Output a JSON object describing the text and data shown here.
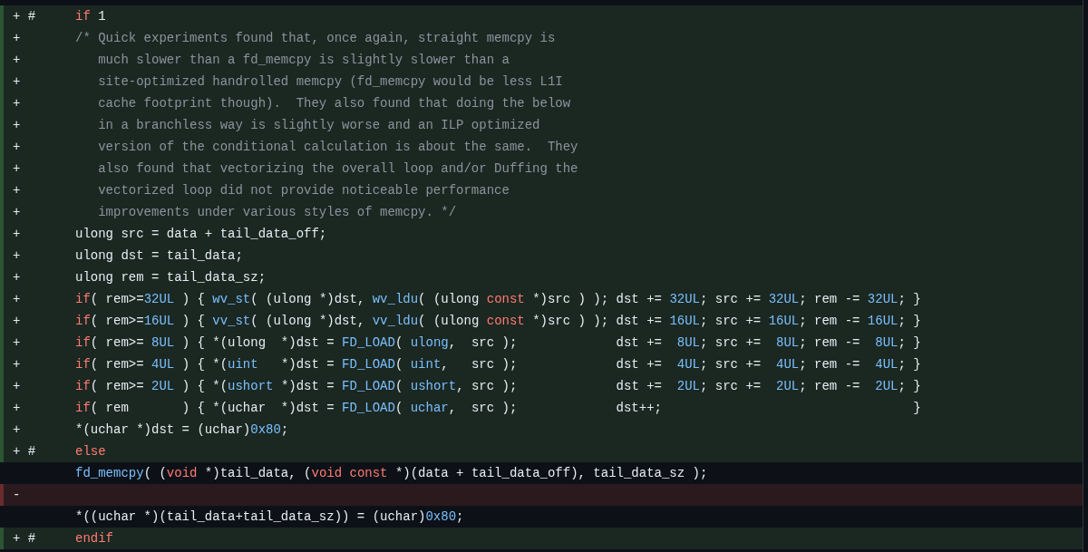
{
  "diff_lines": [
    {
      "kind": "add",
      "marker": "+ #",
      "code": [
        {
          "kind": "kw",
          "s": "if"
        },
        {
          "kind": "p",
          "s": " 1"
        }
      ]
    },
    {
      "kind": "add",
      "marker": "+",
      "code": [
        {
          "kind": "cm",
          "s": "/* Quick experiments found that, once again, straight memcpy is"
        }
      ]
    },
    {
      "kind": "add",
      "marker": "+",
      "code": [
        {
          "kind": "cm",
          "s": "   much slower than a fd_memcpy is slightly slower than a"
        }
      ]
    },
    {
      "kind": "add",
      "marker": "+",
      "code": [
        {
          "kind": "cm",
          "s": "   site-optimized handrolled memcpy (fd_memcpy would be less L1I"
        }
      ]
    },
    {
      "kind": "add",
      "marker": "+",
      "code": [
        {
          "kind": "cm",
          "s": "   cache footprint though).  They also found that doing the below"
        }
      ]
    },
    {
      "kind": "add",
      "marker": "+",
      "code": [
        {
          "kind": "cm",
          "s": "   in a branchless way is slightly worse and an ILP optimized"
        }
      ]
    },
    {
      "kind": "add",
      "marker": "+",
      "code": [
        {
          "kind": "cm",
          "s": "   version of the conditional calculation is about the same.  They"
        }
      ]
    },
    {
      "kind": "add",
      "marker": "+",
      "code": [
        {
          "kind": "cm",
          "s": "   also found that vectorizing the overall loop and/or Duffing the"
        }
      ]
    },
    {
      "kind": "add",
      "marker": "+",
      "code": [
        {
          "kind": "cm",
          "s": "   vectorized loop did not provide noticeable performance"
        }
      ]
    },
    {
      "kind": "add",
      "marker": "+",
      "code": [
        {
          "kind": "cm",
          "s": "   improvements under various styles of memcpy. */"
        }
      ]
    },
    {
      "kind": "add",
      "marker": "+",
      "code": [
        {
          "kind": "p",
          "s": "ulong src = data + tail_data_off;"
        }
      ]
    },
    {
      "kind": "add",
      "marker": "+",
      "code": [
        {
          "kind": "p",
          "s": "ulong dst = tail_data;"
        }
      ]
    },
    {
      "kind": "add",
      "marker": "+",
      "code": [
        {
          "kind": "p",
          "s": "ulong rem = tail_data_sz;"
        }
      ]
    },
    {
      "kind": "add",
      "marker": "+",
      "code": [
        {
          "kind": "kw",
          "s": "if"
        },
        {
          "kind": "p",
          "s": "( rem>="
        },
        {
          "kind": "fn",
          "s": "32UL"
        },
        {
          "kind": "p",
          "s": " ) { "
        },
        {
          "kind": "fn",
          "s": "wv_st"
        },
        {
          "kind": "p",
          "s": "( (ulong *)dst, "
        },
        {
          "kind": "fn",
          "s": "wv_ldu"
        },
        {
          "kind": "p",
          "s": "( (ulong "
        },
        {
          "kind": "kw",
          "s": "const"
        },
        {
          "kind": "p",
          "s": " *)src ) ); dst += "
        },
        {
          "kind": "fn",
          "s": "32UL"
        },
        {
          "kind": "p",
          "s": "; src += "
        },
        {
          "kind": "fn",
          "s": "32UL"
        },
        {
          "kind": "p",
          "s": "; rem -= "
        },
        {
          "kind": "fn",
          "s": "32UL"
        },
        {
          "kind": "p",
          "s": "; }"
        }
      ]
    },
    {
      "kind": "add",
      "marker": "+",
      "code": [
        {
          "kind": "kw",
          "s": "if"
        },
        {
          "kind": "p",
          "s": "( rem>="
        },
        {
          "kind": "fn",
          "s": "16UL"
        },
        {
          "kind": "p",
          "s": " ) { "
        },
        {
          "kind": "fn",
          "s": "vv_st"
        },
        {
          "kind": "p",
          "s": "( (ulong *)dst, "
        },
        {
          "kind": "fn",
          "s": "vv_ldu"
        },
        {
          "kind": "p",
          "s": "( (ulong "
        },
        {
          "kind": "kw",
          "s": "const"
        },
        {
          "kind": "p",
          "s": " *)src ) ); dst += "
        },
        {
          "kind": "fn",
          "s": "16UL"
        },
        {
          "kind": "p",
          "s": "; src += "
        },
        {
          "kind": "fn",
          "s": "16UL"
        },
        {
          "kind": "p",
          "s": "; rem -= "
        },
        {
          "kind": "fn",
          "s": "16UL"
        },
        {
          "kind": "p",
          "s": "; }"
        }
      ]
    },
    {
      "kind": "add",
      "marker": "+",
      "code": [
        {
          "kind": "kw",
          "s": "if"
        },
        {
          "kind": "p",
          "s": "( rem>= "
        },
        {
          "kind": "fn",
          "s": "8UL"
        },
        {
          "kind": "p",
          "s": " ) { *(ulong  *)dst = "
        },
        {
          "kind": "fn",
          "s": "FD_LOAD"
        },
        {
          "kind": "p",
          "s": "( "
        },
        {
          "kind": "fn",
          "s": "ulong"
        },
        {
          "kind": "p",
          "s": ",  src );             dst +=  "
        },
        {
          "kind": "fn",
          "s": "8UL"
        },
        {
          "kind": "p",
          "s": "; src +=  "
        },
        {
          "kind": "fn",
          "s": "8UL"
        },
        {
          "kind": "p",
          "s": "; rem -=  "
        },
        {
          "kind": "fn",
          "s": "8UL"
        },
        {
          "kind": "p",
          "s": "; }"
        }
      ]
    },
    {
      "kind": "add",
      "marker": "+",
      "code": [
        {
          "kind": "kw",
          "s": "if"
        },
        {
          "kind": "p",
          "s": "( rem>= "
        },
        {
          "kind": "fn",
          "s": "4UL"
        },
        {
          "kind": "p",
          "s": " ) { *("
        },
        {
          "kind": "fn",
          "s": "uint"
        },
        {
          "kind": "p",
          "s": "   *)dst = "
        },
        {
          "kind": "fn",
          "s": "FD_LOAD"
        },
        {
          "kind": "p",
          "s": "( "
        },
        {
          "kind": "fn",
          "s": "uint"
        },
        {
          "kind": "p",
          "s": ",   src );             dst +=  "
        },
        {
          "kind": "fn",
          "s": "4UL"
        },
        {
          "kind": "p",
          "s": "; src +=  "
        },
        {
          "kind": "fn",
          "s": "4UL"
        },
        {
          "kind": "p",
          "s": "; rem -=  "
        },
        {
          "kind": "fn",
          "s": "4UL"
        },
        {
          "kind": "p",
          "s": "; }"
        }
      ]
    },
    {
      "kind": "add",
      "marker": "+",
      "code": [
        {
          "kind": "kw",
          "s": "if"
        },
        {
          "kind": "p",
          "s": "( rem>= "
        },
        {
          "kind": "fn",
          "s": "2UL"
        },
        {
          "kind": "p",
          "s": " ) { *("
        },
        {
          "kind": "fn",
          "s": "ushort"
        },
        {
          "kind": "p",
          "s": " *)dst = "
        },
        {
          "kind": "fn",
          "s": "FD_LOAD"
        },
        {
          "kind": "p",
          "s": "( "
        },
        {
          "kind": "fn",
          "s": "ushort"
        },
        {
          "kind": "p",
          "s": ", src );             dst +=  "
        },
        {
          "kind": "fn",
          "s": "2UL"
        },
        {
          "kind": "p",
          "s": "; src +=  "
        },
        {
          "kind": "fn",
          "s": "2UL"
        },
        {
          "kind": "p",
          "s": "; rem -=  "
        },
        {
          "kind": "fn",
          "s": "2UL"
        },
        {
          "kind": "p",
          "s": "; }"
        }
      ]
    },
    {
      "kind": "add",
      "marker": "+",
      "code": [
        {
          "kind": "kw",
          "s": "if"
        },
        {
          "kind": "p",
          "s": "( rem       ) { *(uchar  *)dst = "
        },
        {
          "kind": "fn",
          "s": "FD_LOAD"
        },
        {
          "kind": "p",
          "s": "( "
        },
        {
          "kind": "fn",
          "s": "uchar"
        },
        {
          "kind": "p",
          "s": ",  src );             dst++;                                 }"
        }
      ]
    },
    {
      "kind": "add",
      "marker": "+",
      "code": [
        {
          "kind": "p",
          "s": "*(uchar *)dst = (uchar)"
        },
        {
          "kind": "fn",
          "s": "0x80"
        },
        {
          "kind": "p",
          "s": ";"
        }
      ]
    },
    {
      "kind": "add",
      "marker": "+ #",
      "code": [
        {
          "kind": "kw",
          "s": "else"
        }
      ]
    },
    {
      "kind": "ctx",
      "code": [
        {
          "kind": "fn",
          "s": "fd_memcpy"
        },
        {
          "kind": "p",
          "s": "( ("
        },
        {
          "kind": "kw",
          "s": "void"
        },
        {
          "kind": "p",
          "s": " *)tail_data, ("
        },
        {
          "kind": "kw",
          "s": "void const"
        },
        {
          "kind": "p",
          "s": " *)(data + tail_data_off), tail_data_sz );"
        }
      ]
    },
    {
      "kind": "del",
      "marker": "-"
    },
    {
      "kind": "ctx",
      "code": [
        {
          "kind": "p",
          "s": "*((uchar *)(tail_data+tail_data_sz)) = (uchar)"
        },
        {
          "kind": "fn",
          "s": "0x80"
        },
        {
          "kind": "p",
          "s": ";"
        }
      ]
    },
    {
      "kind": "add",
      "marker": "+ #",
      "code": [
        {
          "kind": "kw",
          "s": "endif"
        }
      ]
    }
  ]
}
